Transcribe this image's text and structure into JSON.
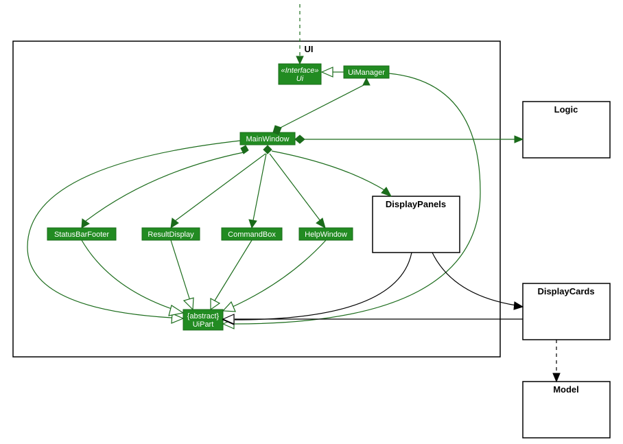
{
  "package": {
    "title": "UI"
  },
  "classes": {
    "ui_interface": {
      "stereotype": "«Interface»",
      "name": "Ui"
    },
    "ui_manager": {
      "name": "UiManager"
    },
    "main_window": {
      "name": "MainWindow"
    },
    "status_bar_footer": {
      "name": "StatusBarFooter"
    },
    "result_display": {
      "name": "ResultDisplay"
    },
    "command_box": {
      "name": "CommandBox"
    },
    "help_window": {
      "name": "HelpWindow"
    },
    "ui_part": {
      "stereotype": "{abstract}",
      "name": "UiPart"
    },
    "display_panels": {
      "name": "DisplayPanels"
    },
    "display_cards": {
      "name": "DisplayCards"
    },
    "logic": {
      "name": "Logic"
    },
    "model": {
      "name": "Model"
    }
  }
}
